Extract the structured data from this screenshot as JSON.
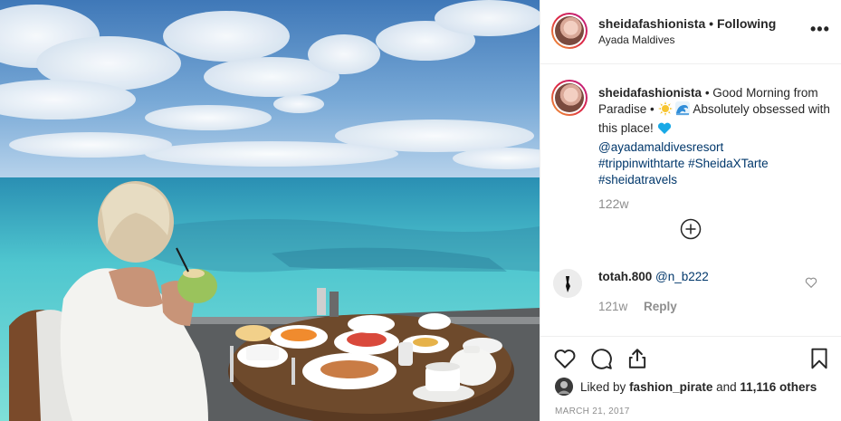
{
  "post": {
    "username": "sheidafashionista",
    "separator": "•",
    "follow_status": "Following",
    "location": "Ayada Maldives",
    "more_label": "•••",
    "caption": {
      "username": "sheidafashionista",
      "part1": "• Good Morning from Paradise •",
      "part2": "Absolutely obsessed with this place!",
      "mention": "@ayadamaldivesresort",
      "hashtags": [
        "#trippinwithtarte",
        "#SheidaXTarte",
        "#sheidatravels"
      ],
      "emojis": [
        "sun-icon",
        "wave-icon",
        "blue-heart-icon"
      ],
      "time": "122w"
    },
    "comment": {
      "username": "totah.800",
      "text": "@n_b222",
      "time": "121w",
      "reply_label": "Reply"
    },
    "likes": {
      "prefix": "Liked by",
      "liker": "fashion_pirate",
      "and": "and",
      "count": "11,116 others"
    },
    "date": "MARCH 21, 2017"
  },
  "colors": {
    "text": "#262626",
    "muted": "#8e8e8e",
    "link": "#00376b",
    "border": "#efefef",
    "story_ring": [
      "#f09433",
      "#bc1888"
    ]
  }
}
